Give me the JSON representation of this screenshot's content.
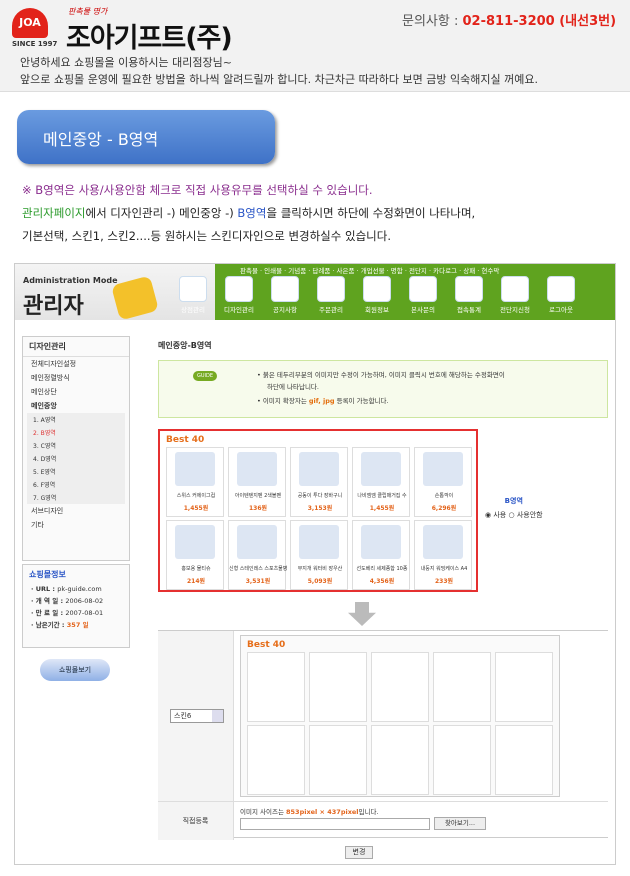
{
  "header": {
    "logo_mark": "JOA",
    "since": "SINCE 1997",
    "slogan": "판촉물 명가",
    "company": "조아기프트(주)",
    "contact_label": "문의사항 : ",
    "contact_value": "02-811-3200 (내선3번)",
    "intro_line1": "안녕하세요 쇼핑몰을 이용하시는 대리점장님~",
    "intro_line2": "앞으로 쇼핑몰 운영에 필요한 방법을 하나씩 알려드릴까 합니다. 차근차근 따라하다 보면 금방 익숙해지실 꺼예요."
  },
  "banner": {
    "title": "메인중앙 - B영역"
  },
  "instructions": {
    "l1": "※ B영역은 사용/사용안함 체크로 직접 사용유무를 선택하실 수 있습니다.",
    "l2a": "관리자페이지",
    "l2b": "에서 디자인관리 -) 메인중앙 -) ",
    "l2c": "B영역",
    "l2d": "을 클릭하시면 하단에 수정화면이 나타나며,",
    "l3": "기본선택, 스킨1, 스킨2....등 원하시는 스킨디자인으로 변경하실수 있습니다."
  },
  "admin": {
    "mode": "Administration Mode",
    "title": "관리자",
    "topnav": "판촉물 · 인쇄물 · 기념품 · 답례품 · 사은품 · 개업선물 · 명함 · 전단지 · 카다로그 · 상패 · 현수막",
    "menu": [
      "상점관리",
      "디자인관리",
      "공지사항",
      "주문관리",
      "회원정보",
      "본사문의",
      "접속통계",
      "전단지신청",
      "로그아웃"
    ],
    "side_title": "디자인관리",
    "side_items": [
      "전체디자인설정",
      "메인정렬방식",
      "메인상단",
      "메인중앙"
    ],
    "side_sub": [
      "1. A영역",
      "2. B영역",
      "3. C영역",
      "4. D영역",
      "5. E영역",
      "6. F영역",
      "7. G영역"
    ],
    "side_items2": [
      "서브디자인",
      "기타"
    ],
    "info_title": "쇼핑몰정보",
    "info": [
      {
        "k": "· URL : ",
        "v": "pk-guide.com"
      },
      {
        "k": "· 개 역 일 : ",
        "v": "2006-08-02"
      },
      {
        "k": "· 만 료 일 : ",
        "v": "2007-08-01"
      },
      {
        "k": "· 남은기간 : ",
        "v": "357 일"
      }
    ],
    "shop_button": "쇼핑몰보기",
    "page_title": "메인중앙-B영역",
    "guide_badge": "GUIDE",
    "guide1": "• 붉은 테두리부분의 이미지만 수정이 가능하며, 이미지 클릭시 번호에 해당하는 수정화면이",
    "guide2": "하단에 나타납니다.",
    "guide3a": "• 이미지 확장자는 ",
    "guide3b": "gif, jpg",
    "guide3c": " 등록이 가능합니다.",
    "best_title": "Best 40",
    "products": [
      {
        "name": "스위스 커에이그컵",
        "price": "1,455원"
      },
      {
        "name": "아이텐텐지펜 2색볼펜",
        "price": "136원"
      },
      {
        "name": "공동이 투다 장바구니",
        "price": "3,153원"
      },
      {
        "name": "나비엠엠 클립매거집 수",
        "price": "1,455원"
      },
      {
        "name": "손톱깍이",
        "price": "6,296원"
      },
      {
        "name": "홍보용 물티슈",
        "price": "214원"
      },
      {
        "name": "신형 스테인레스 스포츠물병",
        "price": "3,531원"
      },
      {
        "name": "무지개 워터비 장우산",
        "price": "5,093원"
      },
      {
        "name": "선도베리 세제종합 10종",
        "price": "4,356원"
      },
      {
        "name": "내둥지 워밍케이스 A4",
        "price": "233원"
      }
    ],
    "b_area": "B영역",
    "opt_use": "사용",
    "opt_nouse": "사용안함",
    "skin_value": "스킨6",
    "direct_label": "직접등록",
    "size_a": "이미지 사이즈는 ",
    "size_b": "853pixel × 437pixel",
    "size_c": "입니다.",
    "browse": "찾아보기...",
    "change": "변경"
  }
}
